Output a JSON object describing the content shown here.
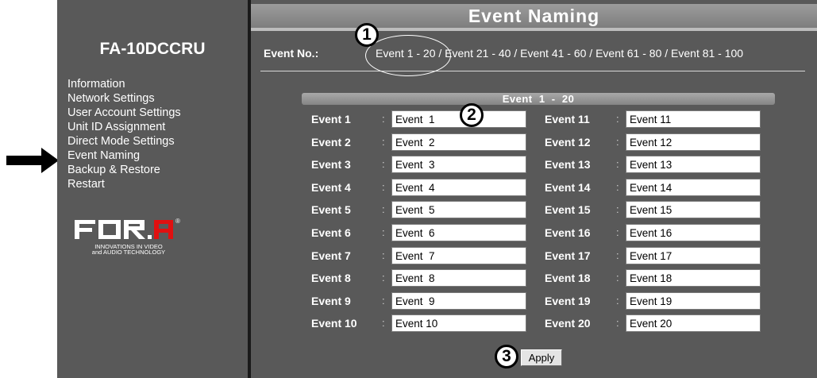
{
  "sidebar": {
    "model": "FA-10DCCRU",
    "menu": [
      "Information",
      "Network Settings",
      "User Account Settings",
      "Unit ID Assignment",
      "Direct Mode Settings",
      "Event Naming",
      "Backup & Restore",
      "Restart"
    ],
    "logo": {
      "text": "FOR.A",
      "registered": "®",
      "tagline_1": "INNOVATIONS IN VIDEO",
      "tagline_2": "and AUDIO TECHNOLOGY"
    }
  },
  "header": {
    "title": "Event Naming"
  },
  "event_no": {
    "label": "Event No.:",
    "pages": [
      "Event 1 - 20",
      "Event 21 - 40",
      "Event 41 - 60",
      "Event 61 - 80",
      "Event 81 - 100"
    ],
    "separator": " / "
  },
  "section": {
    "title": "Event  1  -  20"
  },
  "events_left": [
    {
      "label": "Event 1",
      "value": "Event  1"
    },
    {
      "label": "Event 2",
      "value": "Event  2"
    },
    {
      "label": "Event 3",
      "value": "Event  3"
    },
    {
      "label": "Event 4",
      "value": "Event  4"
    },
    {
      "label": "Event 5",
      "value": "Event  5"
    },
    {
      "label": "Event 6",
      "value": "Event  6"
    },
    {
      "label": "Event 7",
      "value": "Event  7"
    },
    {
      "label": "Event 8",
      "value": "Event  8"
    },
    {
      "label": "Event 9",
      "value": "Event  9"
    },
    {
      "label": "Event 10",
      "value": "Event 10"
    }
  ],
  "events_right": [
    {
      "label": "Event 11",
      "value": "Event 11"
    },
    {
      "label": "Event 12",
      "value": "Event 12"
    },
    {
      "label": "Event 13",
      "value": "Event 13"
    },
    {
      "label": "Event 14",
      "value": "Event 14"
    },
    {
      "label": "Event 15",
      "value": "Event 15"
    },
    {
      "label": "Event 16",
      "value": "Event 16"
    },
    {
      "label": "Event 17",
      "value": "Event 17"
    },
    {
      "label": "Event 18",
      "value": "Event 18"
    },
    {
      "label": "Event 19",
      "value": "Event 19"
    },
    {
      "label": "Event 20",
      "value": "Event 20"
    }
  ],
  "colon": ":",
  "apply_label": "Apply",
  "callouts": [
    "1",
    "2",
    "3"
  ],
  "colors": {
    "panel": "#595959",
    "divider": "#1a1a1a",
    "text": "#ffffff"
  },
  "icons": {
    "side_arrow": "right-arrow-icon"
  }
}
